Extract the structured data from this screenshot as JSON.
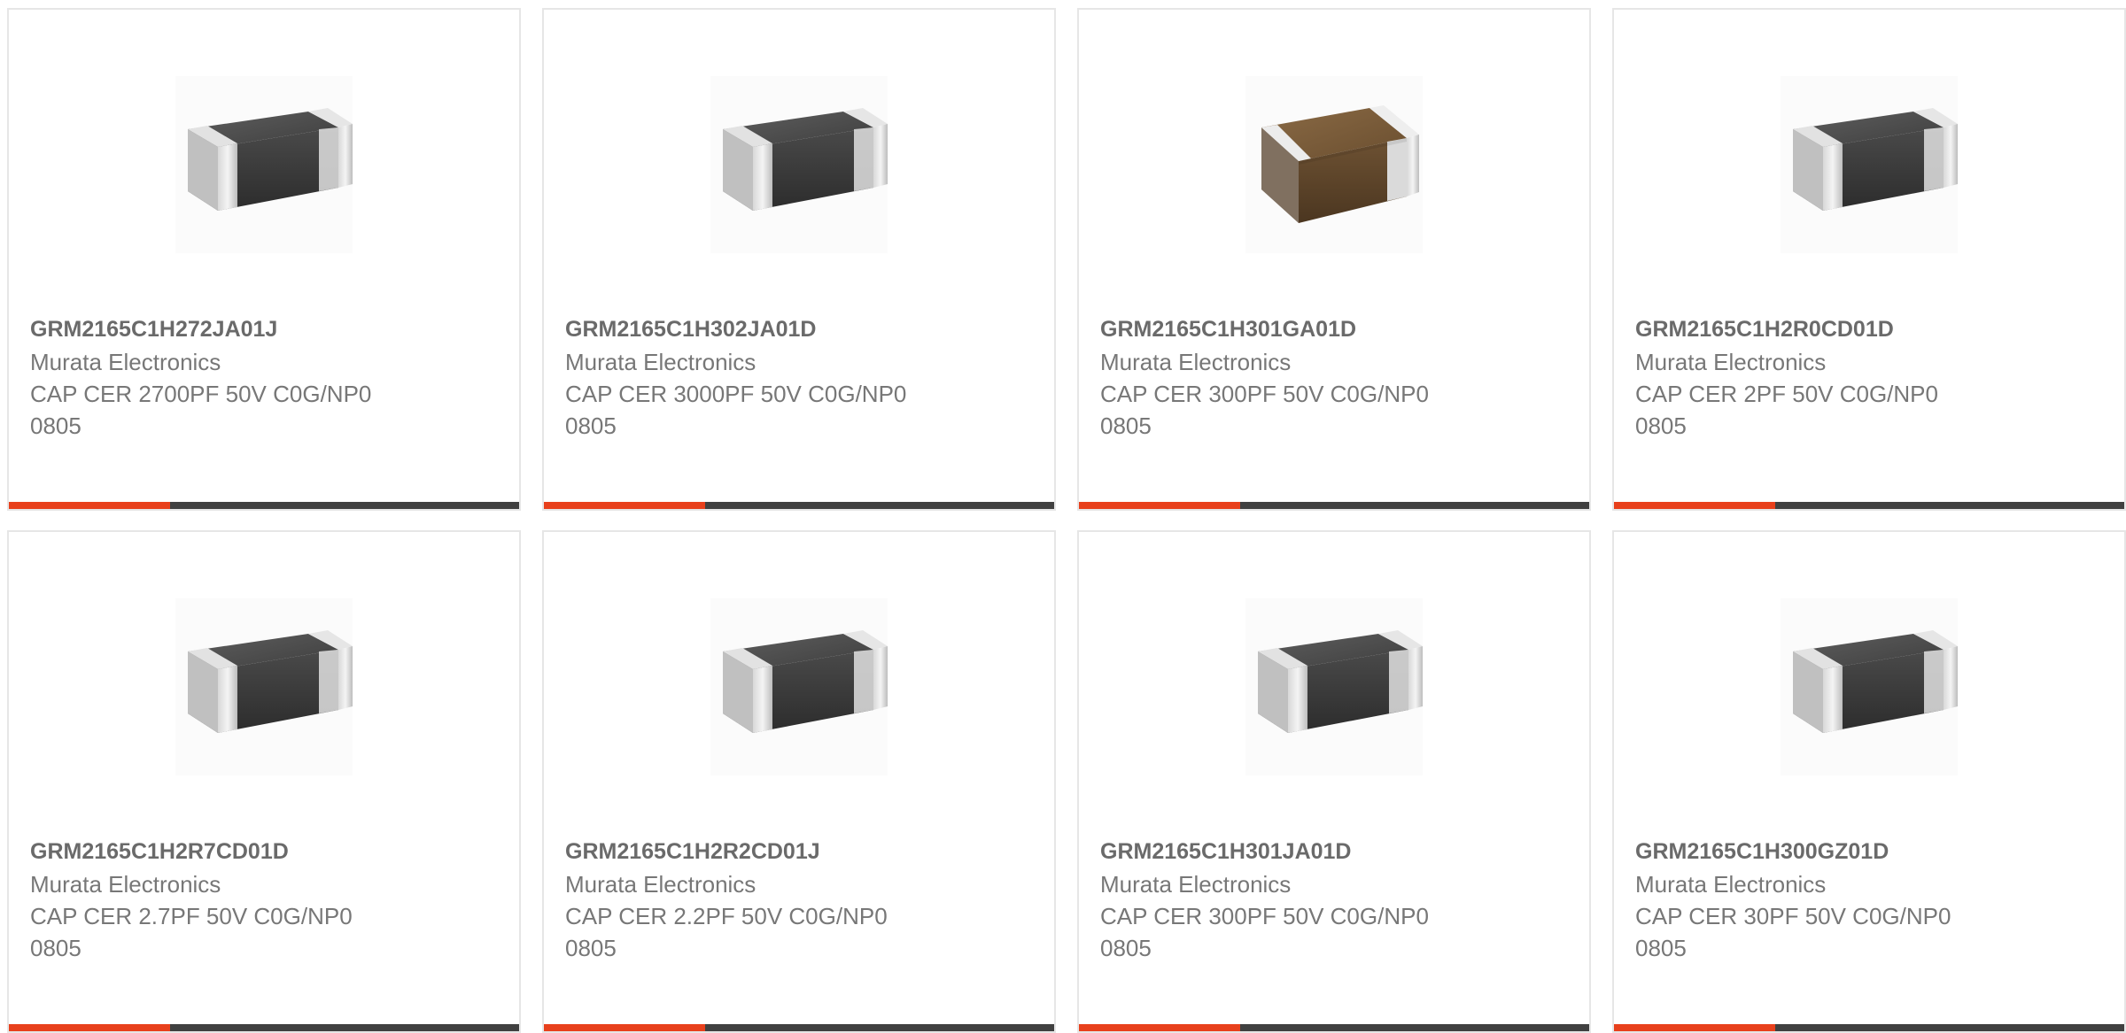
{
  "colors": {
    "accent": "#e8401c",
    "bar_dark": "#404040",
    "card_border": "#e6e6e6"
  },
  "products": [
    {
      "part_number": "GRM2165C1H272JA01J",
      "manufacturer": "Murata Electronics",
      "description": "CAP CER 2700PF 50V C0G/NP0",
      "package": "0805",
      "image": "mlcc-gray-chip-image"
    },
    {
      "part_number": "GRM2165C1H302JA01D",
      "manufacturer": "Murata Electronics",
      "description": "CAP CER 3000PF 50V C0G/NP0",
      "package": "0805",
      "image": "mlcc-gray-chip-image"
    },
    {
      "part_number": "GRM2165C1H301GA01D",
      "manufacturer": "Murata Electronics",
      "description": "CAP CER 300PF 50V C0G/NP0",
      "package": "0805",
      "image": "mlcc-brown-chip-image"
    },
    {
      "part_number": "GRM2165C1H2R0CD01D",
      "manufacturer": "Murata Electronics",
      "description": "CAP CER 2PF 50V C0G/NP0",
      "package": "0805",
      "image": "mlcc-gray-chip-image"
    },
    {
      "part_number": "GRM2165C1H2R7CD01D",
      "manufacturer": "Murata Electronics",
      "description": "CAP CER 2.7PF 50V C0G/NP0",
      "package": "0805",
      "image": "mlcc-gray-chip-image"
    },
    {
      "part_number": "GRM2165C1H2R2CD01J",
      "manufacturer": "Murata Electronics",
      "description": "CAP CER 2.2PF 50V C0G/NP0",
      "package": "0805",
      "image": "mlcc-gray-chip-image"
    },
    {
      "part_number": "GRM2165C1H301JA01D",
      "manufacturer": "Murata Electronics",
      "description": "CAP CER 300PF 50V C0G/NP0",
      "package": "0805",
      "image": "mlcc-gray-chip-image"
    },
    {
      "part_number": "GRM2165C1H300GZ01D",
      "manufacturer": "Murata Electronics",
      "description": "CAP CER 30PF 50V C0G/NP0",
      "package": "0805",
      "image": "mlcc-gray-chip-image"
    }
  ]
}
